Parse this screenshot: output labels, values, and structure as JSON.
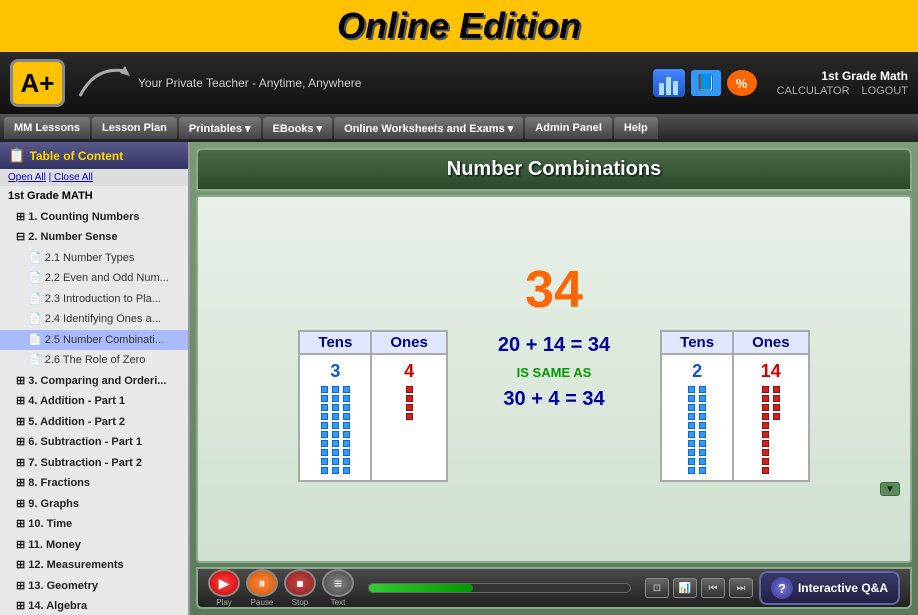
{
  "banner": {
    "title": "Online Edition"
  },
  "header": {
    "logo": "A+",
    "tagline": "Your Private Teacher - Anytime, Anywhere",
    "grade": "1st Grade Math",
    "calculator_label": "CALCULATOR",
    "logout_label": "LOGOUT"
  },
  "nav": {
    "items": [
      {
        "id": "mm-lessons",
        "label": "MM Lessons",
        "active": false
      },
      {
        "id": "lesson-plan",
        "label": "Lesson Plan",
        "active": false
      },
      {
        "id": "printables",
        "label": "Printables ▾",
        "active": false
      },
      {
        "id": "ebooks",
        "label": "EBooks ▾",
        "active": false
      },
      {
        "id": "worksheets",
        "label": "Online Worksheets and Exams ▾",
        "active": false
      },
      {
        "id": "admin",
        "label": "Admin Panel",
        "active": false
      },
      {
        "id": "help",
        "label": "Help",
        "active": false
      }
    ]
  },
  "sidebar": {
    "title": "Table of Content",
    "open_label": "Open All",
    "close_label": "Close All",
    "tree": [
      {
        "level": 0,
        "label": "1st Grade MATH",
        "type": "root"
      },
      {
        "level": 1,
        "label": "1. Counting Numbers",
        "type": "chapter"
      },
      {
        "level": 1,
        "label": "2. Number Sense",
        "type": "chapter",
        "expanded": true
      },
      {
        "level": 2,
        "label": "2.1 Number Types",
        "type": "lesson"
      },
      {
        "level": 2,
        "label": "2.2 Even and Odd Num...",
        "type": "lesson"
      },
      {
        "level": 2,
        "label": "2.3 Introduction to Pla...",
        "type": "lesson"
      },
      {
        "level": 2,
        "label": "2.4 Identifying Ones a...",
        "type": "lesson"
      },
      {
        "level": 2,
        "label": "2.5 Number Combinati...",
        "type": "lesson",
        "selected": true
      },
      {
        "level": 2,
        "label": "2.6 The Role of Zero",
        "type": "lesson"
      },
      {
        "level": 1,
        "label": "3. Comparing and Orderi...",
        "type": "chapter"
      },
      {
        "level": 1,
        "label": "4. Addition - Part 1",
        "type": "chapter"
      },
      {
        "level": 1,
        "label": "5. Addition - Part 2",
        "type": "chapter"
      },
      {
        "level": 1,
        "label": "6. Subtraction - Part 1",
        "type": "chapter"
      },
      {
        "level": 1,
        "label": "7. Subtraction - Part 2",
        "type": "chapter"
      },
      {
        "level": 1,
        "label": "8. Fractions",
        "type": "chapter"
      },
      {
        "level": 1,
        "label": "9. Graphs",
        "type": "chapter"
      },
      {
        "level": 1,
        "label": "10. Time",
        "type": "chapter"
      },
      {
        "level": 1,
        "label": "11. Money",
        "type": "chapter"
      },
      {
        "level": 1,
        "label": "12. Measurements",
        "type": "chapter"
      },
      {
        "level": 1,
        "label": "13. Geometry",
        "type": "chapter"
      },
      {
        "level": 1,
        "label": "14. Algebra",
        "type": "chapter"
      }
    ]
  },
  "lesson": {
    "title": "Number Combinations",
    "number": "34",
    "left_table": {
      "headers": [
        "Tens",
        "Ones"
      ],
      "values": [
        "3",
        "4"
      ]
    },
    "right_table": {
      "headers": [
        "Tens",
        "Ones"
      ],
      "values": [
        "2",
        "14"
      ]
    },
    "equation1": "20 + 14 = 34",
    "is_same_as": "IS SAME AS",
    "equation2": "30 + 4 = 34"
  },
  "controls": {
    "play_label": "Play",
    "pause_label": "Pause",
    "stop_label": "Stop",
    "text_label": "Text",
    "qa_label": "Interactive Q&A"
  }
}
